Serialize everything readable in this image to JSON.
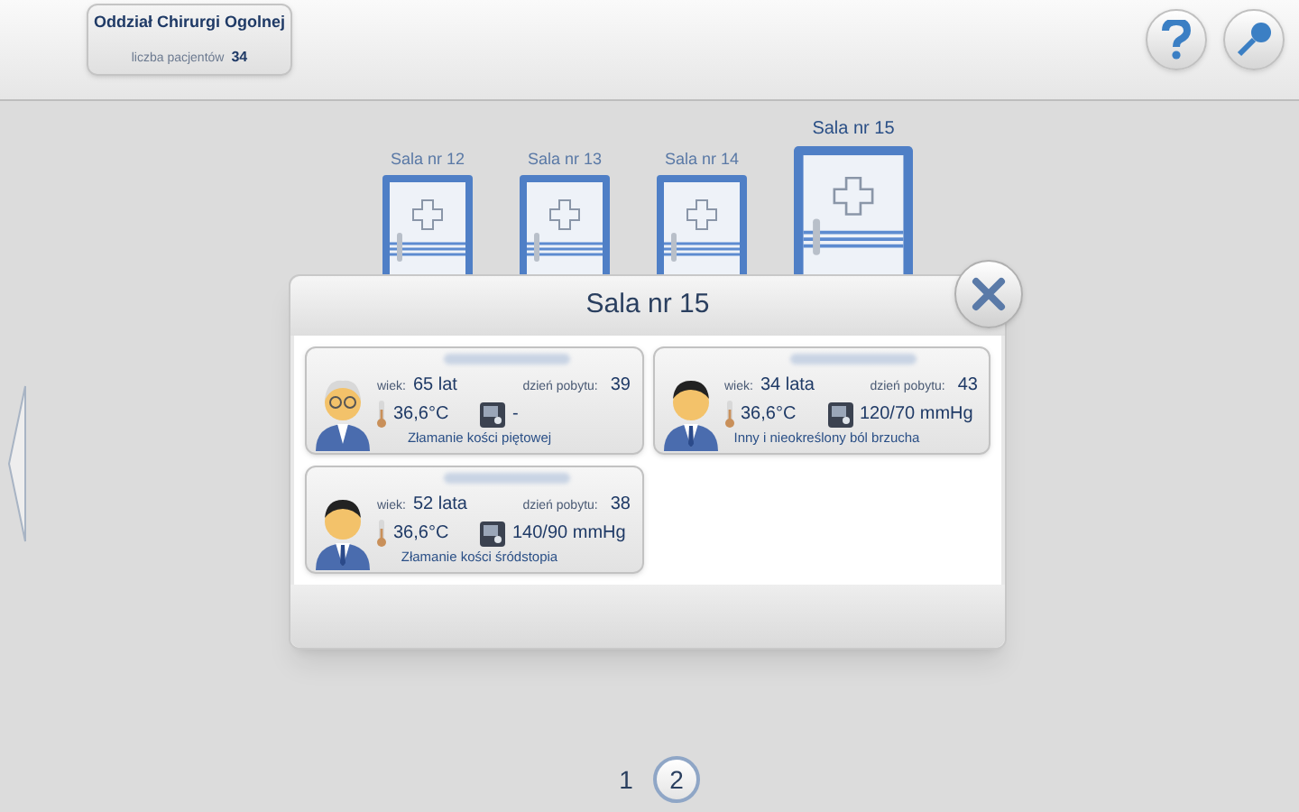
{
  "ward": {
    "title": "Oddział Chirurgi Ogolnej",
    "patients_label": "liczba pacjentów",
    "patients_count": "34"
  },
  "rooms": [
    {
      "label": "Sala nr 12",
      "selected": false
    },
    {
      "label": "Sala nr 13",
      "selected": false
    },
    {
      "label": "Sala nr 14",
      "selected": false
    },
    {
      "label": "Sala nr 15",
      "selected": true
    }
  ],
  "dialog": {
    "title": "Sala nr 15",
    "patients": [
      {
        "kind": "elderly",
        "age_label": "wiek:",
        "age": "65 lat",
        "stay_label": "dzień pobytu:",
        "stay": "39",
        "temperature": "36,6°C",
        "pressure": "-",
        "diagnosis": "Złamanie kości piętowej"
      },
      {
        "kind": "man",
        "age_label": "wiek:",
        "age": "34 lata",
        "stay_label": "dzień pobytu:",
        "stay": "43",
        "temperature": "36,6°C",
        "pressure": "120/70 mmHg",
        "diagnosis": "Inny i nieokreślony ból brzucha"
      },
      {
        "kind": "man",
        "age_label": "wiek:",
        "age": "52 lata",
        "stay_label": "dzień pobytu:",
        "stay": "38",
        "temperature": "36,6°C",
        "pressure": "140/90 mmHg",
        "diagnosis": "Złamanie kości śródstopia"
      }
    ]
  },
  "pages": [
    {
      "label": "1",
      "selected": false
    },
    {
      "label": "2",
      "selected": true
    }
  ]
}
